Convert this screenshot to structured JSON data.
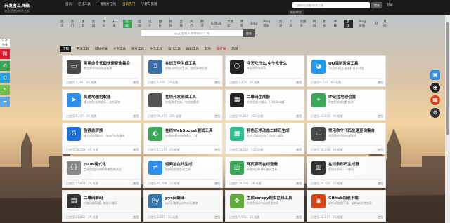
{
  "topbar": {
    "logo": "开发者工具箱",
    "logo_sub": "来这里找到你的工具",
    "nav": [
      "首页",
      "在线工具",
      "一键图片压缩",
      "当前热门",
      "了解与反馈"
    ],
    "nav_highlight_index": 3,
    "search_placeholder": "二维码生成器/在线工具",
    "search_btn": "搜索",
    "login": "登录",
    "lang": "简体中文"
  },
  "catbar": {
    "items": [
      "首页",
      "热门",
      "搜索",
      "资讯",
      "教程",
      "开发",
      "前端",
      "后端",
      "设计",
      "图片",
      "视频",
      "音频",
      "文档",
      "翻译",
      "Github",
      "大模型",
      "博客",
      "Blog",
      "Bing壁纸",
      "资源",
      "工具",
      "云服务",
      "网盘",
      "影视",
      "书籍",
      "游戏",
      "Bing搜图",
      "AI",
      "其他"
    ],
    "green_index": 6,
    "dark_index": 25
  },
  "main_search": {
    "placeholder": "在这里输入你要找的工具",
    "btn": "搜索"
  },
  "tabs": {
    "items": [
      "全部",
      "开发工具",
      "网站相关",
      "文字工具",
      "图片工具",
      "生活工具",
      "设计工具",
      "编码工具",
      "其他",
      "排行榜",
      "新增"
    ],
    "active_index": 0,
    "red_index": 9
  },
  "cards": [
    {
      "title": "常用命令代码快速查询集合",
      "desc": "常用命令代码快速查询",
      "views": "3,264",
      "likes": "43",
      "use": "使用",
      "icon": "terminal-icon",
      "color": "#4a4a4a"
    },
    {
      "title": "在线马甲生成工具",
      "desc": "在线马甲生成工具，提供多种生成",
      "views": "1,820",
      "likes": "19",
      "use": "使用",
      "icon": "vest-icon",
      "color": "#3b6ea5"
    },
    {
      "title": "今天吃什么,中午吃什么",
      "desc": "今天中午吃什么",
      "views": "2,476",
      "likes": "58",
      "use": "使用",
      "icon": "food-icon",
      "color": "#222222"
    },
    {
      "title": "QQ强制对话工具",
      "desc": "可以在QQ上面强制打开对话",
      "views": "6,502",
      "likes": "64",
      "use": "使用",
      "icon": "qq-icon",
      "color": "#1e9bf0"
    },
    {
      "title": "高速地图拾取器",
      "desc": "输入地址查询坐标，点击获取",
      "views": "4,237",
      "likes": "36",
      "use": "使用",
      "icon": "map-icon",
      "color": "#2f8fe8"
    },
    {
      "title": "在线开发测试工具",
      "desc": "在线测试工具，包含加解密",
      "views": "98,475",
      "likes": "205",
      "use": "使用",
      "icon": "code-icon",
      "color": "#555555"
    },
    {
      "title": "二维码生成器",
      "desc": "在线生成二维码，LOGO二维码",
      "views": "96,842",
      "likes": "452",
      "use": "使用",
      "icon": "qr-icon",
      "color": "#222222"
    },
    {
      "title": "IP定位地理位置",
      "desc": "IP定位地理位置查询",
      "views": "42,016",
      "likes": "94",
      "use": "使用",
      "icon": "location-icon",
      "color": "#3aa757"
    },
    {
      "title": "伪静态转换",
      "desc": "输入对应Nginx、Apache伪静态",
      "views": "18,209",
      "likes": "45",
      "use": "使用",
      "icon": "g-icon",
      "color": "#1e6fd9"
    },
    {
      "title": "在线WebSocket测试工具",
      "desc": "在线websocket测试工具",
      "views": "17,175",
      "likes": "63",
      "use": "使用",
      "icon": "websocket-icon",
      "color": "#3aa757"
    },
    {
      "title": "特色艺术动态二维码生成",
      "desc": "艺术二维码生成，动态二维码",
      "views": "28,532",
      "likes": "112",
      "use": "使用",
      "icon": "art-qr-icon",
      "color": "#2dbd8e"
    },
    {
      "title": "常用命令代码快速查询集合",
      "desc": "常用命令代码快速查询",
      "views": "16,438",
      "likes": "44",
      "use": "使用",
      "icon": "terminal-icon",
      "color": "#4a4a4a"
    },
    {
      "title": "JSON格式化",
      "desc": "工具包含JSON的带颜色格式化",
      "views": "17,609",
      "likes": "74",
      "use": "使用",
      "icon": "json-icon",
      "color": "#888888"
    },
    {
      "title": "短网址在线生成",
      "desc": "短网址在线生成工具",
      "views": "45,709",
      "likes": "31",
      "use": "使用",
      "icon": "link-icon",
      "color": "#2f8fe8"
    },
    {
      "title": "网页源码在线查看",
      "desc": "获取网页HTML源码工具",
      "views": "28,106",
      "likes": "28",
      "use": "使用",
      "icon": "source-icon",
      "color": "#3aa757"
    },
    {
      "title": "在线条形码生成器",
      "desc": "生成条形码，一维码",
      "views": "20,435",
      "likes": "27",
      "use": "使用",
      "icon": "barcode-icon",
      "color": "#333333"
    },
    {
      "title": "二维码解码",
      "desc": "二维码解码器，解析二维码",
      "views": "13,862",
      "likes": "29",
      "use": "使用",
      "icon": "qr-decode-icon",
      "color": "#333333"
    },
    {
      "title": "pyc反编译",
      "desc": "pyc反编译,python反编译",
      "views": "2,657",
      "likes": "16",
      "use": "使用",
      "icon": "python-icon",
      "color": "#3776ab"
    },
    {
      "title": "生成scrapy爬虫在线工具",
      "desc": "在线生成scrapy爬虫代码",
      "views": "6,918",
      "likes": "23",
      "use": "使用",
      "icon": "scrapy-icon",
      "color": "#60a839"
    },
    {
      "title": "Github加速下载",
      "desc": "github加速下载，github文件加速",
      "views": "42,377",
      "likes": "91",
      "use": "使用",
      "icon": "github-icon",
      "color": "#d84315"
    }
  ],
  "share": {
    "count": "1.2k",
    "count_label": "分享",
    "buttons": [
      "微博",
      "微信",
      "QQ",
      "复制",
      "分享"
    ]
  },
  "labels": {
    "views_prefix": "已使用",
    "likes_suffix": "收藏"
  }
}
